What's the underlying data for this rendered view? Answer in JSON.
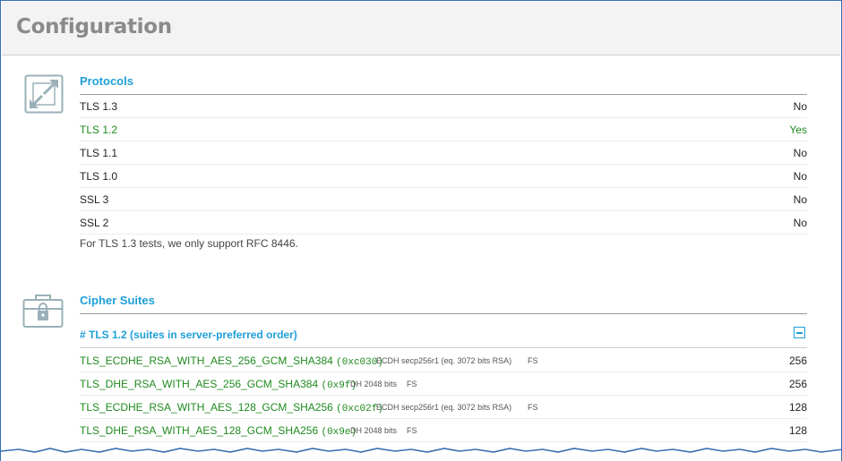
{
  "header": {
    "title": "Configuration"
  },
  "protocols": {
    "title": "Protocols",
    "icon": "arrows-expand-icon",
    "rows": [
      {
        "label": "TLS 1.3",
        "value": "No",
        "ok": false
      },
      {
        "label": "TLS 1.2",
        "value": "Yes",
        "ok": true
      },
      {
        "label": "TLS 1.1",
        "value": "No",
        "ok": false
      },
      {
        "label": "TLS 1.0",
        "value": "No",
        "ok": false
      },
      {
        "label": "SSL 3",
        "value": "No",
        "ok": false
      },
      {
        "label": "SSL 2",
        "value": "No",
        "ok": false
      }
    ],
    "note": "For TLS 1.3 tests, we only support RFC 8446."
  },
  "ciphers": {
    "title": "Cipher Suites",
    "icon": "toolbox-lock-icon",
    "group_title": "# TLS 1.2 (suites in server-preferred order)",
    "suites": [
      {
        "name": "TLS_ECDHE_RSA_WITH_AES_256_GCM_SHA384",
        "code": "(0xc030)",
        "detail": "ECDH secp256r1 (eq. 3072 bits RSA)",
        "fs": "FS",
        "bits": "256"
      },
      {
        "name": "TLS_DHE_RSA_WITH_AES_256_GCM_SHA384",
        "code": "(0x9f)",
        "detail": "DH 2048 bits",
        "fs": "FS",
        "bits": "256"
      },
      {
        "name": "TLS_ECDHE_RSA_WITH_AES_128_GCM_SHA256",
        "code": "(0xc02f)",
        "detail": "ECDH secp256r1 (eq. 3072 bits RSA)",
        "fs": "FS",
        "bits": "128"
      },
      {
        "name": "TLS_DHE_RSA_WITH_AES_128_GCM_SHA256",
        "code": "(0x9e)",
        "detail": "DH 2048 bits",
        "fs": "FS",
        "bits": "128"
      }
    ]
  },
  "colors": {
    "accent": "#1e9fd8",
    "ok": "#1f8a1f",
    "frame": "#3a6fb0"
  }
}
